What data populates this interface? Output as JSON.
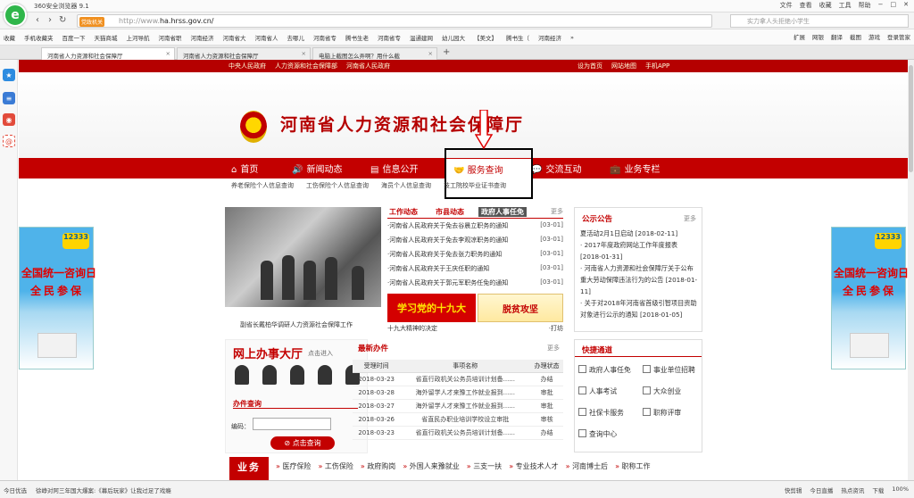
{
  "browser": {
    "title": "360安全浏览器 9.1",
    "menu": [
      "文件",
      "查看",
      "收藏",
      "工具",
      "帮助"
    ],
    "window_controls": [
      "−",
      "□",
      "✕"
    ],
    "secure_badge": "党政机关",
    "url_prefix": "http://www.",
    "url_domain": "ha.hrss.gov.cn/",
    "search_placeholder": "实力拿人头拒绝小学生",
    "bookmarks": [
      "收藏",
      "手机收藏夹",
      "百度一下",
      "天猫商城",
      "上河导航",
      "河南省职",
      "河南经济",
      "河南省大",
      "河南省人",
      "去哪儿",
      "河南省专",
      "腾书生老",
      "河南省专",
      "温通建网",
      "幼儿园大",
      "【美文】",
      "腾书生（",
      "河南经济",
      "»"
    ],
    "bookmark_tools": [
      "扩展",
      "网银",
      "翻译",
      "截图",
      "游戏",
      "登录管家"
    ],
    "tabs": [
      {
        "label": "河南省人力资源和社会保障厅",
        "active": true
      },
      {
        "label": "河南省人力资源和社会保障厅",
        "active": false
      },
      {
        "label": "电脑上截图怎么弄啊？用什么截",
        "active": false
      }
    ],
    "new_tab": "+",
    "status_left": [
      "今日优选",
      "徐峥对阿三年国大爆案:《幕后玩家》让我过足了戏瘾"
    ],
    "status_right": [
      "快剪辑",
      "今日直播",
      "热点资讯",
      "下载",
      "100%"
    ]
  },
  "site": {
    "top_links_left": [
      "中央人民政府",
      "人力资源和社会保障部",
      "河南省人民政府"
    ],
    "top_links_right": [
      "设为首页",
      "网站地图",
      "手机APP"
    ],
    "title": "河南省人力资源和社会保障厅",
    "nav": [
      {
        "label": "首页",
        "icon": "⌂"
      },
      {
        "label": "新闻动态",
        "icon": "🔊"
      },
      {
        "label": "信息公开",
        "icon": "▤"
      },
      {
        "label": "服务查询",
        "icon": "🤝"
      },
      {
        "label": "交流互动",
        "icon": "💬"
      },
      {
        "label": "业务专栏",
        "icon": "💼"
      }
    ],
    "subnav": [
      "养老保险个人信息查询",
      "工伤保险个人信息查询",
      "海员个人信息查询",
      "技工院校毕业证书查询"
    ],
    "photo_caption": "副省长戴柏华调研人力资源社会保障工作",
    "news_tabs": [
      "工作动态",
      "市县动态",
      "政府人事任免"
    ],
    "news_more": "更多",
    "news": [
      {
        "title": "·河南省人民政府关于免去谷晨立职务的通知",
        "date": "[03-01]"
      },
      {
        "title": "·河南省人民政府关于免去李观凉职务的通知",
        "date": "[03-01]"
      },
      {
        "title": "·河南省人民政府关于免去张力职务的通知",
        "date": "[03-01]"
      },
      {
        "title": "·河南省人民政府关于王庆任职的通知",
        "date": "[03-01]"
      },
      {
        "title": "·河南省人民政府关于郭元军职务任免的通知",
        "date": "[03-01]"
      }
    ],
    "promo1": "学习党的十九大",
    "promo2": "脱贫攻坚",
    "promo_caption": "十九大精神的决定",
    "promo_caption_right": "·打坊",
    "notice_title": "公示公告",
    "notice_more": "更多",
    "notices": [
      "夏活动2月1日启动 [2018-02-11]",
      "· 2017年度政府网站工作年度报表 [2018-01-31]",
      "· 河南省人力资源和社会保障厅关于公布重大劳动保障违法行为的公告 [2018-01-11]",
      "· 关于对2018年河南省首级引智项目资助对象进行公示的通知 [2018-01-05]"
    ],
    "side_ad_badge": "12333",
    "side_ad_line1": "全国统一咨询日",
    "side_ad_line2": "全民参保",
    "hall_title": "网上办事大厅",
    "hall_enter": "点击进入",
    "hall_query": "办件查询",
    "hall_code_label": "编码：",
    "hall_button": "点击查询",
    "latest_title": "最新办件",
    "latest_more": "更多",
    "latest_headers": [
      "受理时间",
      "事项名称",
      "办理状态"
    ],
    "latest_rows": [
      [
        "2018-03-23",
        "省直行政机关公务员培训计划备......",
        "办结"
      ],
      [
        "2018-03-28",
        "海外留学人才来豫工作就业报到......",
        "审批"
      ],
      [
        "2018-03-27",
        "海外留学人才来豫工作就业报到......",
        "审批"
      ],
      [
        "2018-03-26",
        "省直民办职业培训学校设立审批",
        "审核"
      ],
      [
        "2018-03-23",
        "省直行政机关公务员培训计划备......",
        "办结"
      ]
    ],
    "quick_title": "快捷通道",
    "quick": [
      "政府人事任免",
      "事业单位招聘",
      "人事考试",
      "大众创业",
      "社保卡服务",
      "职称评审",
      "查询中心"
    ],
    "biz_label": "业务",
    "biz_items": [
      "医疗保险",
      "工伤保险",
      "政府购岗",
      "外国人来豫就业",
      "三支一扶",
      "专业技术人才",
      "河南博士后",
      "职称工作"
    ]
  }
}
